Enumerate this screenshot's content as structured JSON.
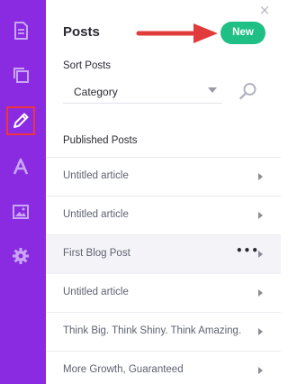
{
  "sidebar": {
    "items": [
      {
        "icon": "page-icon",
        "active": false
      },
      {
        "icon": "layers-icon",
        "active": false
      },
      {
        "icon": "pencil-icon",
        "active": true
      },
      {
        "icon": "font-icon",
        "active": false
      },
      {
        "icon": "image-icon",
        "active": false
      },
      {
        "icon": "gear-icon",
        "active": false
      }
    ],
    "background": "#8a2be2",
    "highlight_border": "#ef3340"
  },
  "panel": {
    "title": "Posts",
    "new_button_label": "New",
    "close_glyph": "×",
    "new_button_color": "#1fbf85",
    "annotation_arrow_color": "#e23b3b"
  },
  "sort": {
    "label": "Sort Posts",
    "selected": "Category"
  },
  "posts": {
    "heading": "Published Posts",
    "more_glyph": "•••",
    "items": [
      {
        "title": "Untitled article",
        "highlighted": false
      },
      {
        "title": "Untitled article",
        "highlighted": false
      },
      {
        "title": "First Blog Post",
        "highlighted": true
      },
      {
        "title": "Untitled article",
        "highlighted": false
      },
      {
        "title": "Think Big. Think Shiny. Think Amazing.",
        "highlighted": false
      },
      {
        "title": "More Growth, Guaranteed",
        "highlighted": false
      }
    ]
  }
}
